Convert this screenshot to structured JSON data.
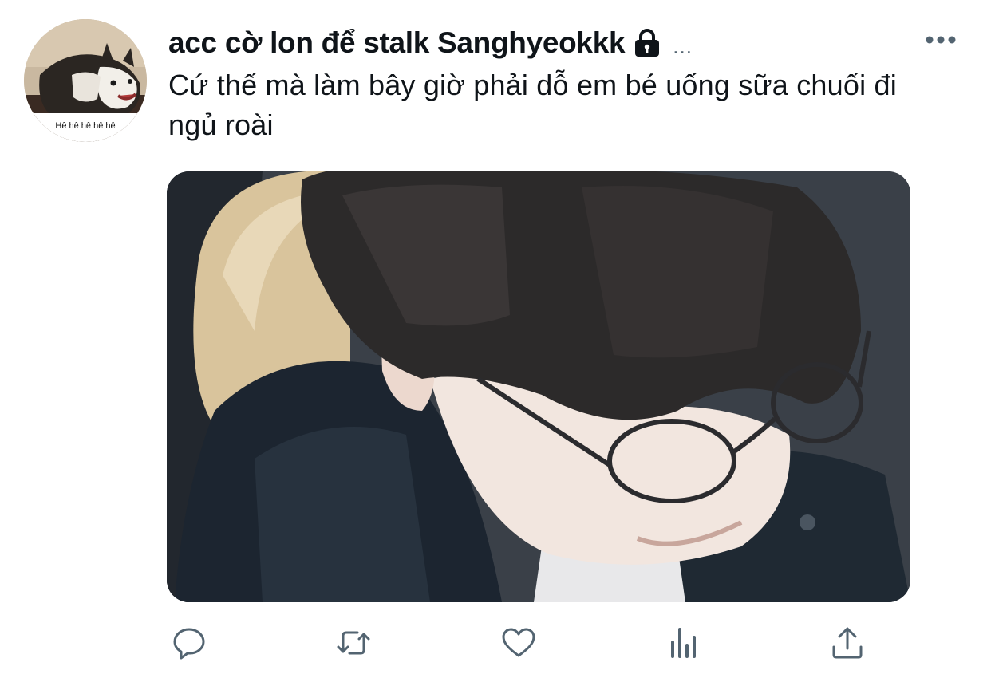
{
  "tweet": {
    "display_name": "acc cờ lon để stalk Sanghyeokkk",
    "header_ellipsis": "...",
    "text": "Cứ thế mà làm bây giờ phải dỗ em bé uống sữa chuối đi ngủ roài",
    "avatar_caption": "Hê hê hê hê hê",
    "protected_icon": "lock-icon",
    "media_description_icon": "photo"
  },
  "actions": [
    {
      "name": "reply",
      "icon": "speech-bubble-icon"
    },
    {
      "name": "retweet",
      "icon": "retweet-arrows-icon"
    },
    {
      "name": "like",
      "icon": "heart-icon"
    },
    {
      "name": "analytics",
      "icon": "bar-chart-icon"
    },
    {
      "name": "share",
      "icon": "share-upload-icon"
    }
  ],
  "colors": {
    "text": "#0f1419",
    "icon_gray": "#536471",
    "background": "#ffffff"
  }
}
